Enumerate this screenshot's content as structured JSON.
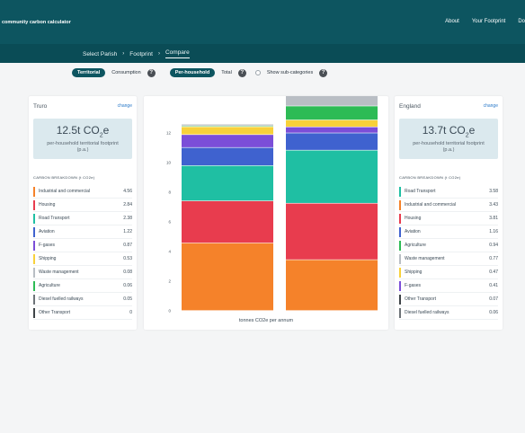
{
  "app": {
    "title": "community carbon calculator",
    "nav": [
      "About",
      "Your Footprint",
      "Do"
    ]
  },
  "breadcrumb": [
    "Select Parish",
    "Footprint",
    "Compare"
  ],
  "controls": {
    "territorial": "Territorial",
    "consumption": "Consumption",
    "per_household": "Per-household",
    "total": "Total",
    "subcategories": "Show sub-categories",
    "help_glyph": "?"
  },
  "left_panel": {
    "place": "Truro",
    "change": "change",
    "amount": "12.5t CO",
    "sub_unit": "2",
    "sup_unit": "e",
    "description": "per-household territorial footprint (p.a.)",
    "breakdown_title": "CARBON BREAKDOWN (t CO2e)",
    "rows": [
      {
        "label": "Industrial and commercial",
        "value": "4.56",
        "color": "#f5822a"
      },
      {
        "label": "Housing",
        "value": "2.84",
        "color": "#e83c4e"
      },
      {
        "label": "Road Transport",
        "value": "2.38",
        "color": "#1fbfa3"
      },
      {
        "label": "Aviation",
        "value": "1.22",
        "color": "#3f62cf"
      },
      {
        "label": "F-gases",
        "value": "0.87",
        "color": "#7b4ed8"
      },
      {
        "label": "Shipping",
        "value": "0.53",
        "color": "#f8d13a"
      },
      {
        "label": "Waste management",
        "value": "0.08",
        "color": "#b9bec4"
      },
      {
        "label": "Agriculture",
        "value": "0.06",
        "color": "#2dbb55"
      },
      {
        "label": "Diesel fuelled railways",
        "value": "0.05",
        "color": "#6d7378"
      },
      {
        "label": "Other Transport",
        "value": "0",
        "color": "#3d4347"
      }
    ]
  },
  "right_panel": {
    "place": "England",
    "change": "change",
    "amount": "13.7t CO",
    "sub_unit": "2",
    "sup_unit": "e",
    "description": "per-household territorial footprint (p.a.)",
    "breakdown_title": "CARBON BREAKDOWN (t CO2e)",
    "rows": [
      {
        "label": "Road Transport",
        "value": "3.58",
        "color": "#1fbfa3"
      },
      {
        "label": "Industrial and commercial",
        "value": "3.43",
        "color": "#f5822a"
      },
      {
        "label": "Housing",
        "value": "3.81",
        "color": "#e83c4e"
      },
      {
        "label": "Aviation",
        "value": "1.16",
        "color": "#3f62cf"
      },
      {
        "label": "Agriculture",
        "value": "0.94",
        "color": "#2dbb55"
      },
      {
        "label": "Waste management",
        "value": "0.77",
        "color": "#b9bec4"
      },
      {
        "label": "Shipping",
        "value": "0.47",
        "color": "#f8d13a"
      },
      {
        "label": "F-gases",
        "value": "0.41",
        "color": "#7b4ed8"
      },
      {
        "label": "Other Transport",
        "value": "0.07",
        "color": "#3d4347"
      },
      {
        "label": "Diesel fuelled railways",
        "value": "0.06",
        "color": "#6d7378"
      }
    ]
  },
  "chart_data": {
    "type": "bar",
    "stacked": true,
    "categories": [
      "Truro",
      "England"
    ],
    "xlabel": "tonnes CO2e per annum",
    "ylim": [
      0,
      14
    ],
    "yticks": [
      0,
      2,
      4,
      6,
      8,
      10,
      12
    ],
    "series": [
      {
        "name": "Industrial and commercial",
        "color": "#f5822a",
        "values": [
          4.56,
          3.43
        ]
      },
      {
        "name": "Housing",
        "color": "#e83c4e",
        "values": [
          2.84,
          3.81
        ]
      },
      {
        "name": "Road Transport",
        "color": "#1fbfa3",
        "values": [
          2.38,
          3.58
        ]
      },
      {
        "name": "Aviation",
        "color": "#3f62cf",
        "values": [
          1.22,
          1.16
        ]
      },
      {
        "name": "F-gases",
        "color": "#7b4ed8",
        "values": [
          0.87,
          0.41
        ]
      },
      {
        "name": "Shipping",
        "color": "#f8d13a",
        "values": [
          0.53,
          0.47
        ]
      },
      {
        "name": "Agriculture",
        "color": "#2dbb55",
        "values": [
          0.06,
          0.94
        ]
      },
      {
        "name": "Waste management",
        "color": "#b9bec4",
        "values": [
          0.08,
          0.77
        ]
      },
      {
        "name": "Diesel fuelled railways",
        "color": "#6d7378",
        "values": [
          0.05,
          0.06
        ]
      },
      {
        "name": "Other Transport",
        "color": "#3d4347",
        "values": [
          0,
          0.07
        ]
      }
    ]
  }
}
